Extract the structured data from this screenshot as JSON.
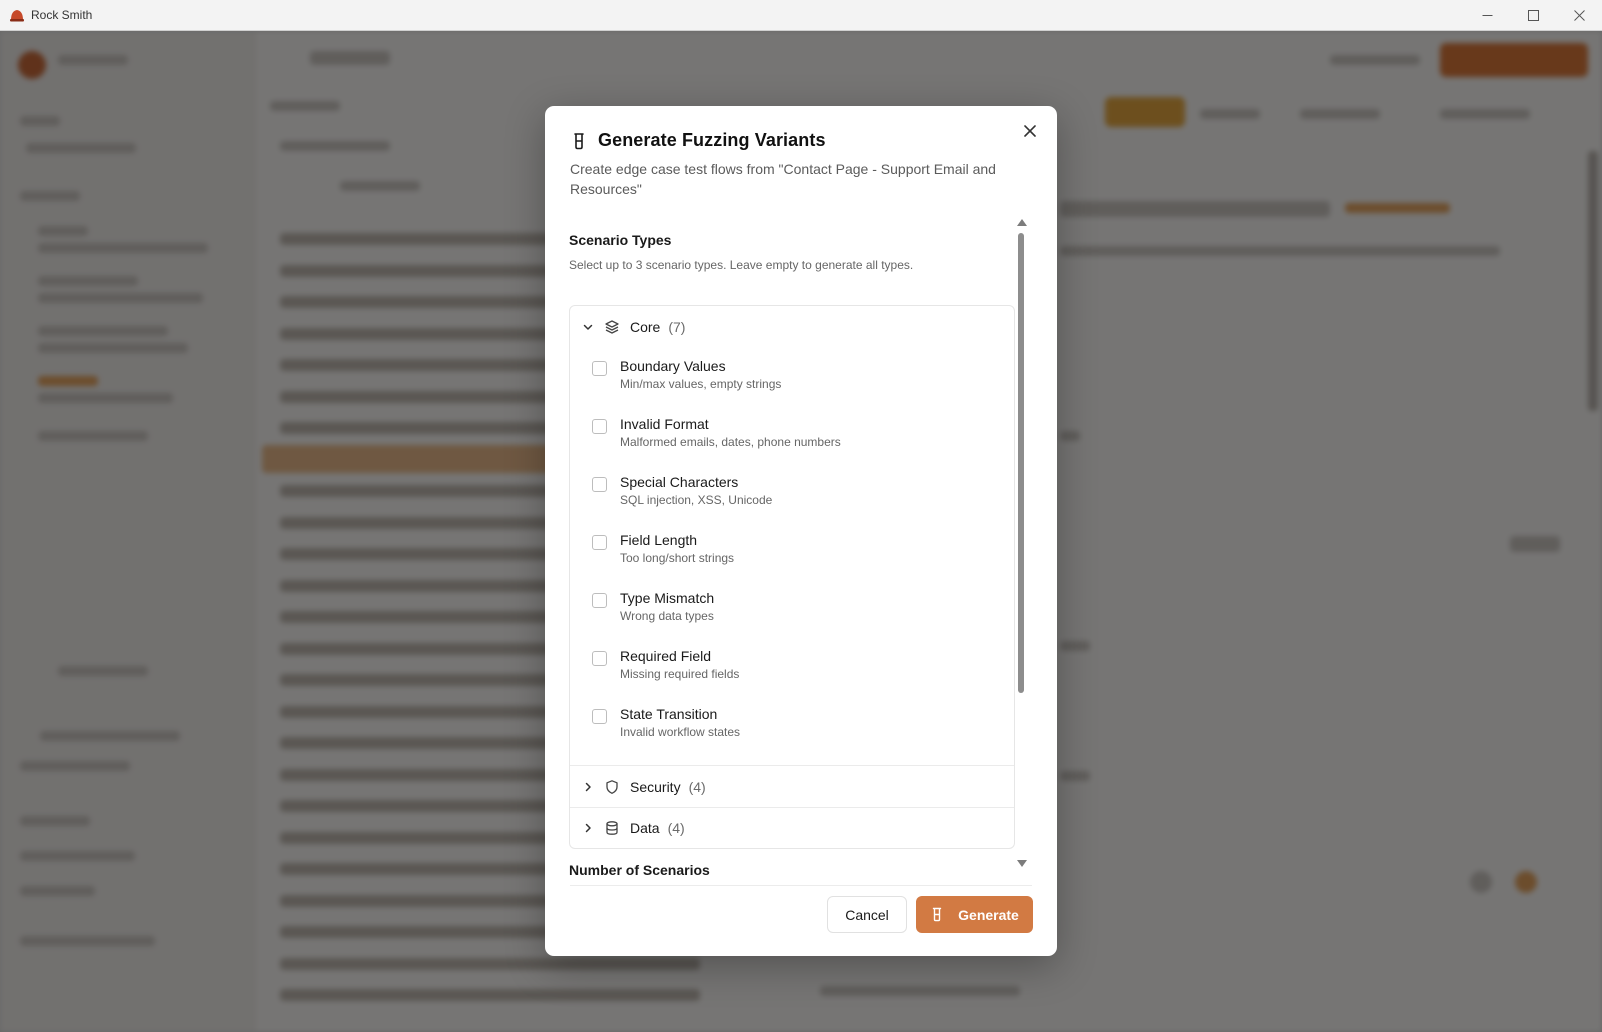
{
  "window": {
    "title": "Rock Smith",
    "controls": {
      "minimize": "—",
      "maximize": "☐",
      "close": "✕"
    }
  },
  "modal": {
    "title": "Generate Fuzzing Variants",
    "description": "Create edge case test flows from \"Contact Page - Support Email and Resources\"",
    "close_label": "✕",
    "scenario_types": {
      "label": "Scenario Types",
      "hint": "Select up to 3 scenario types. Leave empty to generate all types."
    },
    "groups": [
      {
        "name": "Core",
        "count": "(7)",
        "expanded": true,
        "icon": "layers-icon",
        "options": [
          {
            "title": "Boundary Values",
            "subtitle": "Min/max values, empty strings",
            "checked": false
          },
          {
            "title": "Invalid Format",
            "subtitle": "Malformed emails, dates, phone numbers",
            "checked": false
          },
          {
            "title": "Special Characters",
            "subtitle": "SQL injection, XSS, Unicode",
            "checked": false
          },
          {
            "title": "Field Length",
            "subtitle": "Too long/short strings",
            "checked": false
          },
          {
            "title": "Type Mismatch",
            "subtitle": "Wrong data types",
            "checked": false
          },
          {
            "title": "Required Field",
            "subtitle": "Missing required fields",
            "checked": false
          },
          {
            "title": "State Transition",
            "subtitle": "Invalid workflow states",
            "checked": false
          }
        ]
      },
      {
        "name": "Security",
        "count": "(4)",
        "expanded": false,
        "icon": "shield-icon"
      },
      {
        "name": "Data",
        "count": "(4)",
        "expanded": false,
        "icon": "database-icon"
      }
    ],
    "number_of_scenarios_label": "Number of Scenarios",
    "buttons": {
      "cancel": "Cancel",
      "generate": "Generate"
    }
  },
  "colors": {
    "accent": "#d27a43",
    "overlay": "rgba(0,0,0,0.52)"
  }
}
